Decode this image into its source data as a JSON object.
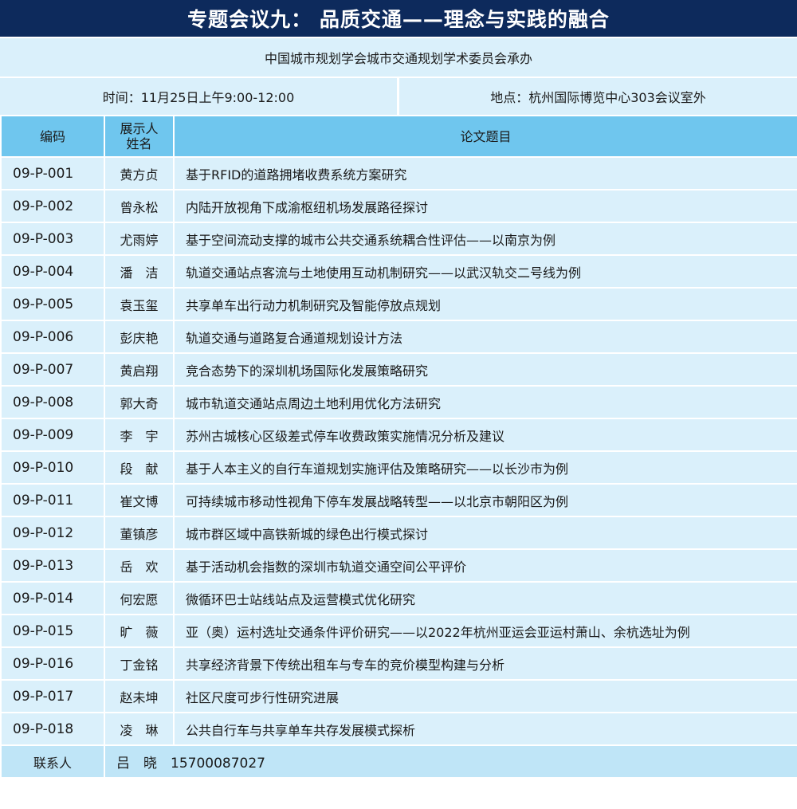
{
  "header": {
    "title": "专题会议九：  品质交通——理念与实践的融合",
    "organizer": "中国城市规划学会城市交通规划学术委员会承办",
    "time": "时间：11月25日上午9:00-12:00",
    "place": "地点：杭州国际博览中心303会议室外"
  },
  "table": {
    "columns": {
      "code": "编码",
      "presenter": "展示人\n姓名",
      "paper": "论文题目"
    },
    "rows": [
      {
        "code": "09-P-001",
        "name": "黄方贞",
        "paper": "基于RFID的道路拥堵收费系统方案研究"
      },
      {
        "code": "09-P-002",
        "name": "曾永松",
        "paper": "内陆开放视角下成渝枢纽机场发展路径探讨"
      },
      {
        "code": "09-P-003",
        "name": "尤雨婷",
        "paper": "基于空间流动支撑的城市公共交通系统耦合性评估——以南京为例"
      },
      {
        "code": "09-P-004",
        "name": "潘　洁",
        "paper": "轨道交通站点客流与土地使用互动机制研究——以武汉轨交二号线为例"
      },
      {
        "code": "09-P-005",
        "name": "袁玉玺",
        "paper": "共享单车出行动力机制研究及智能停放点规划"
      },
      {
        "code": "09-P-006",
        "name": "彭庆艳",
        "paper": "轨道交通与道路复合通道规划设计方法"
      },
      {
        "code": "09-P-007",
        "name": "黄启翔",
        "paper": "竞合态势下的深圳机场国际化发展策略研究"
      },
      {
        "code": "09-P-008",
        "name": "郭大奇",
        "paper": "城市轨道交通站点周边土地利用优化方法研究"
      },
      {
        "code": "09-P-009",
        "name": "李　宇",
        "paper": "苏州古城核心区级差式停车收费政策实施情况分析及建议"
      },
      {
        "code": "09-P-010",
        "name": "段　献",
        "paper": "基于人本主义的自行车道规划实施评估及策略研究——以长沙市为例"
      },
      {
        "code": "09-P-011",
        "name": "崔文博",
        "paper": "可持续城市移动性视角下停车发展战略转型——以北京市朝阳区为例"
      },
      {
        "code": "09-P-012",
        "name": "董镇彦",
        "paper": "城市群区域中高铁新城的绿色出行模式探讨"
      },
      {
        "code": "09-P-013",
        "name": "岳　欢",
        "paper": "基于活动机会指数的深圳市轨道交通空间公平评价"
      },
      {
        "code": "09-P-014",
        "name": "何宏愿",
        "paper": "微循环巴士站线站点及运营模式优化研究"
      },
      {
        "code": "09-P-015",
        "name": "旷　薇",
        "paper": "亚（奥）运村选址交通条件评价研究——以2022年杭州亚运会亚运村萧山、余杭选址为例"
      },
      {
        "code": "09-P-016",
        "name": "丁金铭",
        "paper": "共享经济背景下传统出租车与专车的竞价模型构建与分析"
      },
      {
        "code": "09-P-017",
        "name": "赵未坤",
        "paper": "社区尺度可步行性研究进展"
      },
      {
        "code": "09-P-018",
        "name": "凌　琳",
        "paper": "公共自行车与共享单车共存发展模式探析"
      }
    ]
  },
  "footer": {
    "contact_label": "联系人",
    "contact_value": "吕　晓　15700087027"
  },
  "colors": {
    "title_bg": "#0d2a5c",
    "header_row_bg": "#6fc6ee",
    "cell_bg": "#daf0fb",
    "footer_bg": "#bfe5f7"
  }
}
